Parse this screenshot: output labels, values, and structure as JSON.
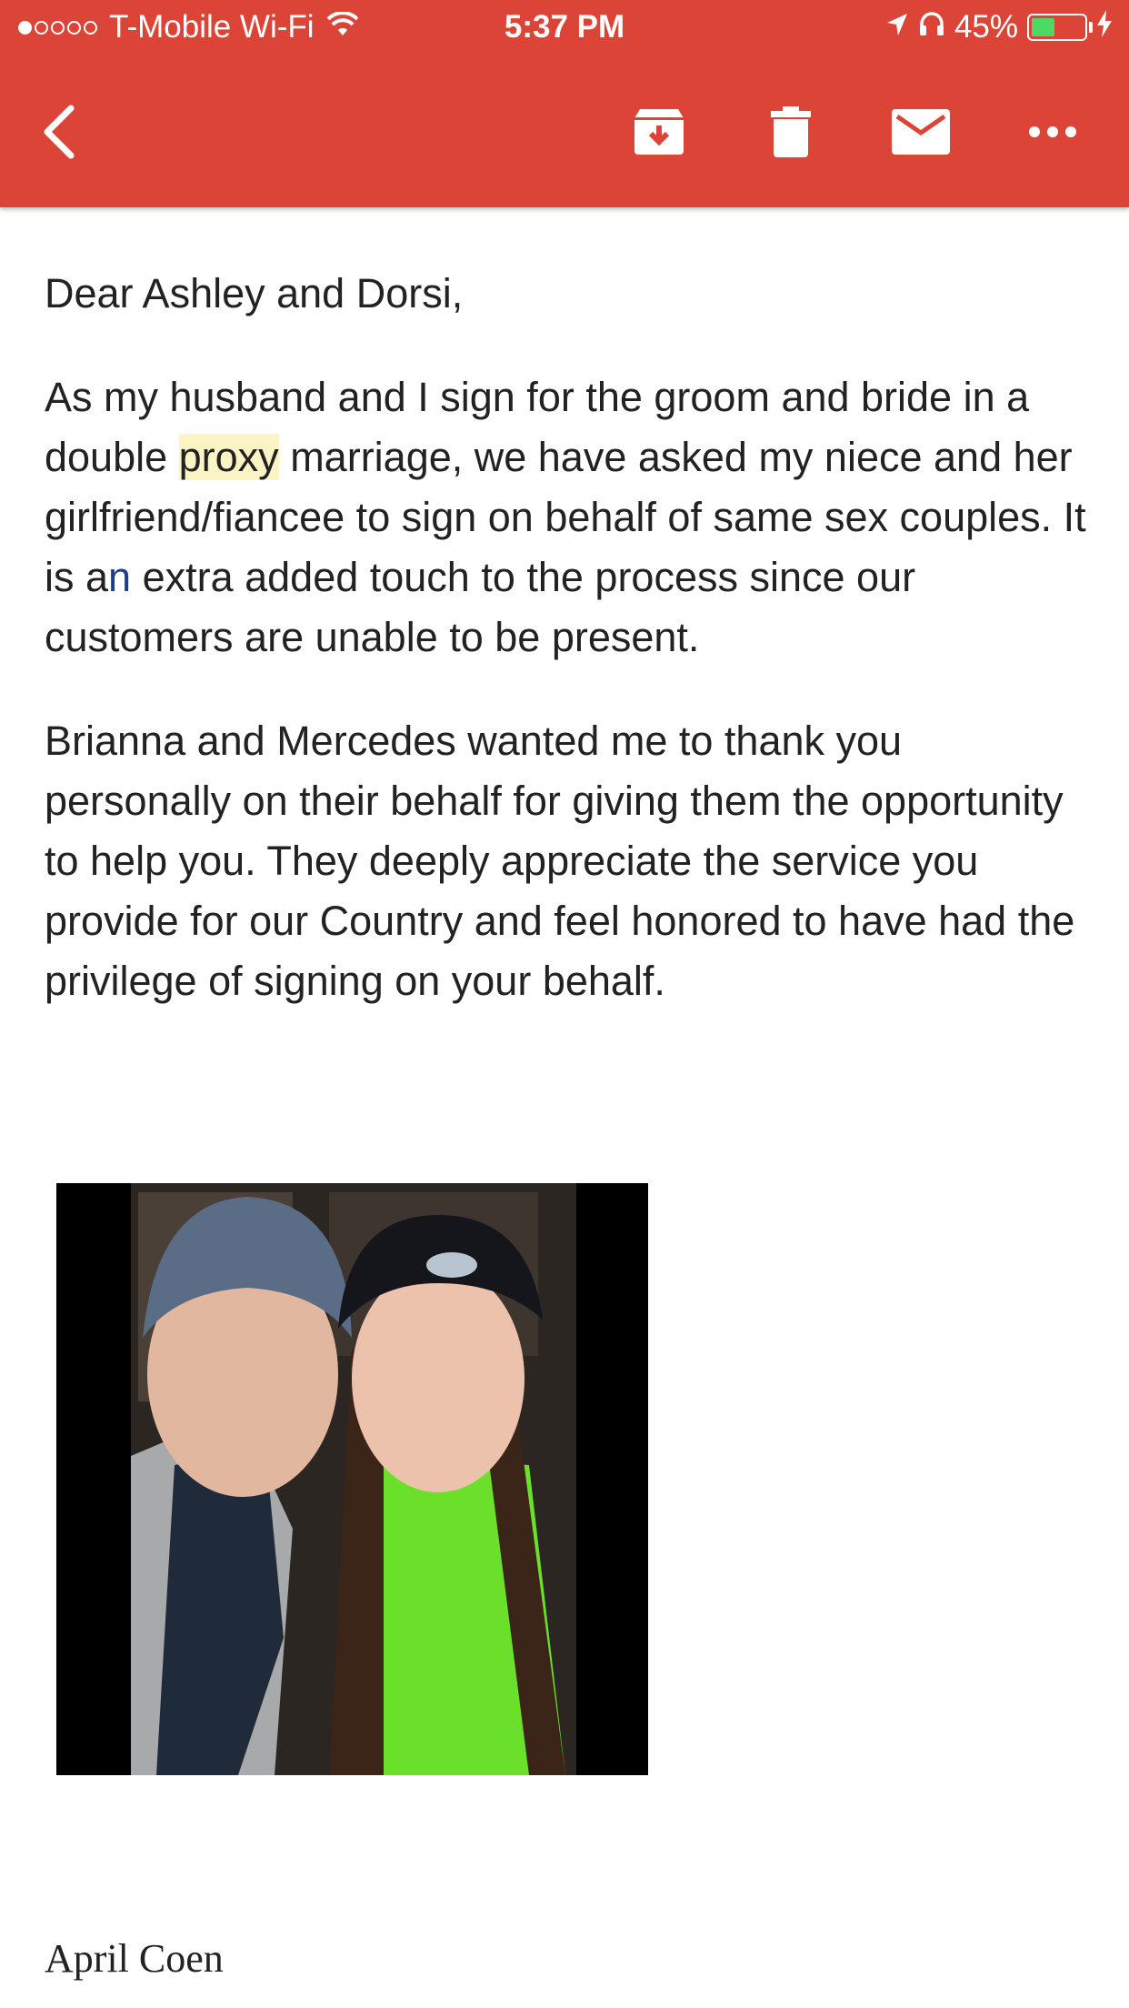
{
  "status_bar": {
    "carrier": "T-Mobile Wi-Fi",
    "time": "5:37 PM",
    "battery_percent": "45%",
    "battery_level": 0.45,
    "signal_bars": 1,
    "signal_total": 5,
    "icons": [
      "wifi-icon",
      "location-arrow-icon",
      "headphones-icon",
      "battery-icon",
      "charging-bolt-icon"
    ]
  },
  "toolbar": {
    "background": "#db4437",
    "icons": [
      "back-arrow-icon",
      "archive-icon",
      "trash-icon",
      "mail-icon",
      "more-dots-icon"
    ]
  },
  "email": {
    "greeting": "Dear Ashley and Dorsi,",
    "para1": {
      "before_highlight": "As my husband and I sign for the groom and bride in a double ",
      "highlight": "proxy",
      "middle": " marriage, we have asked my niece and her girlfriend/fiancee to sign on behalf of same sex couples.  It is a",
      "blue_letter": "n",
      "after": " extra added touch to the process since our customers are unable to be present."
    },
    "para2": "Brianna and Mercedes wanted me to thank you personally on their behalf for giving them the opportunity to help you.  They deeply appreciate the service you provide for our Country and feel honored to have had the privilege of signing on your behalf.",
    "photo_alt": "photo",
    "signature": "April Coen"
  }
}
